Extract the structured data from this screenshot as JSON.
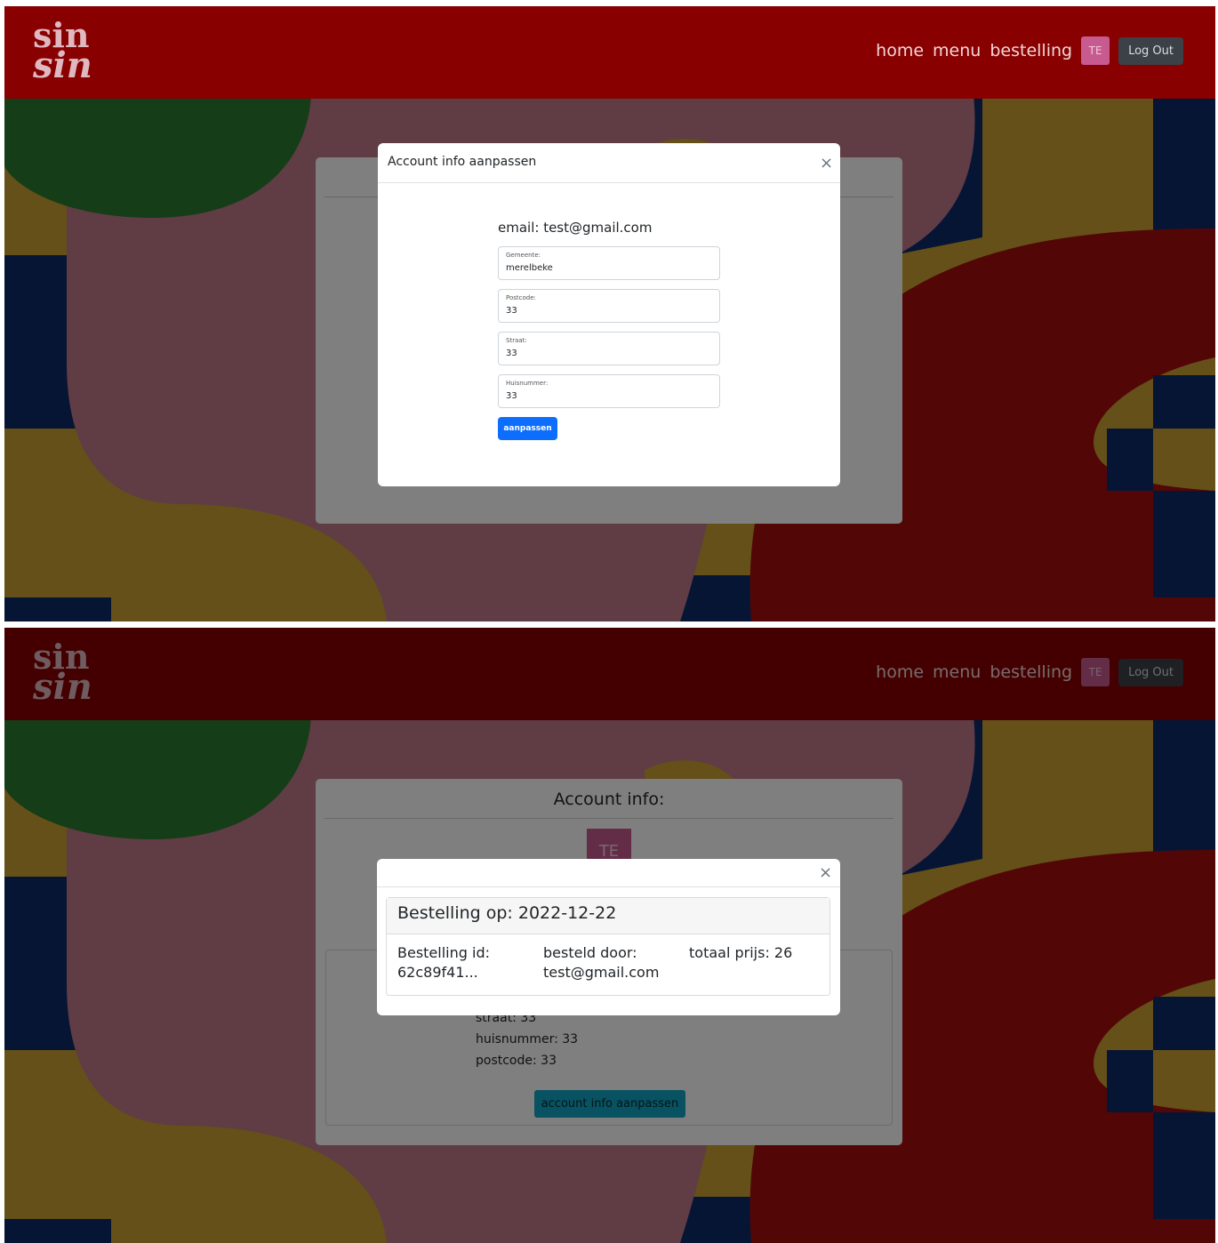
{
  "navbar": {
    "logo_line1": "sin",
    "logo_line2": "sin",
    "links": [
      "home",
      "menu",
      "bestelling"
    ],
    "avatar_initials": "TE",
    "logout_label": "Log Out"
  },
  "account_card": {
    "title": "Account info:",
    "avatar_initials": "TE",
    "straat_line": "straat: 33",
    "huisnummer_line": "huisnummer: 33",
    "postcode_line": "postcode: 33",
    "edit_button_label": "account info aanpassen"
  },
  "edit_modal": {
    "title": "Account info aanpassen",
    "close_glyph": "×",
    "email_line": "email: test@gmail.com",
    "fields": [
      {
        "label": "Gemeente:",
        "value": "merelbeke"
      },
      {
        "label": "Postcode:",
        "value": "33"
      },
      {
        "label": "Straat:",
        "value": "33"
      },
      {
        "label": "Huisnummer:",
        "value": "33"
      }
    ],
    "submit_label": "aanpassen"
  },
  "order_modal": {
    "close_glyph": "×",
    "header": "Bestelling op: 2022-12-22",
    "id_label": "Bestelling id:",
    "id_value": "62c89f41...",
    "by_label": "besteld door:",
    "by_value": "test@gmail.com",
    "total": "totaal prijs: 26"
  },
  "colors": {
    "navbar": "#880000",
    "green": "#2b7a2f",
    "pink": "#c1798b",
    "mustard": "#c9a030",
    "navy": "#0e2a6b",
    "dark_red": "#a70d0d",
    "primary_button": "#0d6efd",
    "info_button": "#10a5c2"
  }
}
